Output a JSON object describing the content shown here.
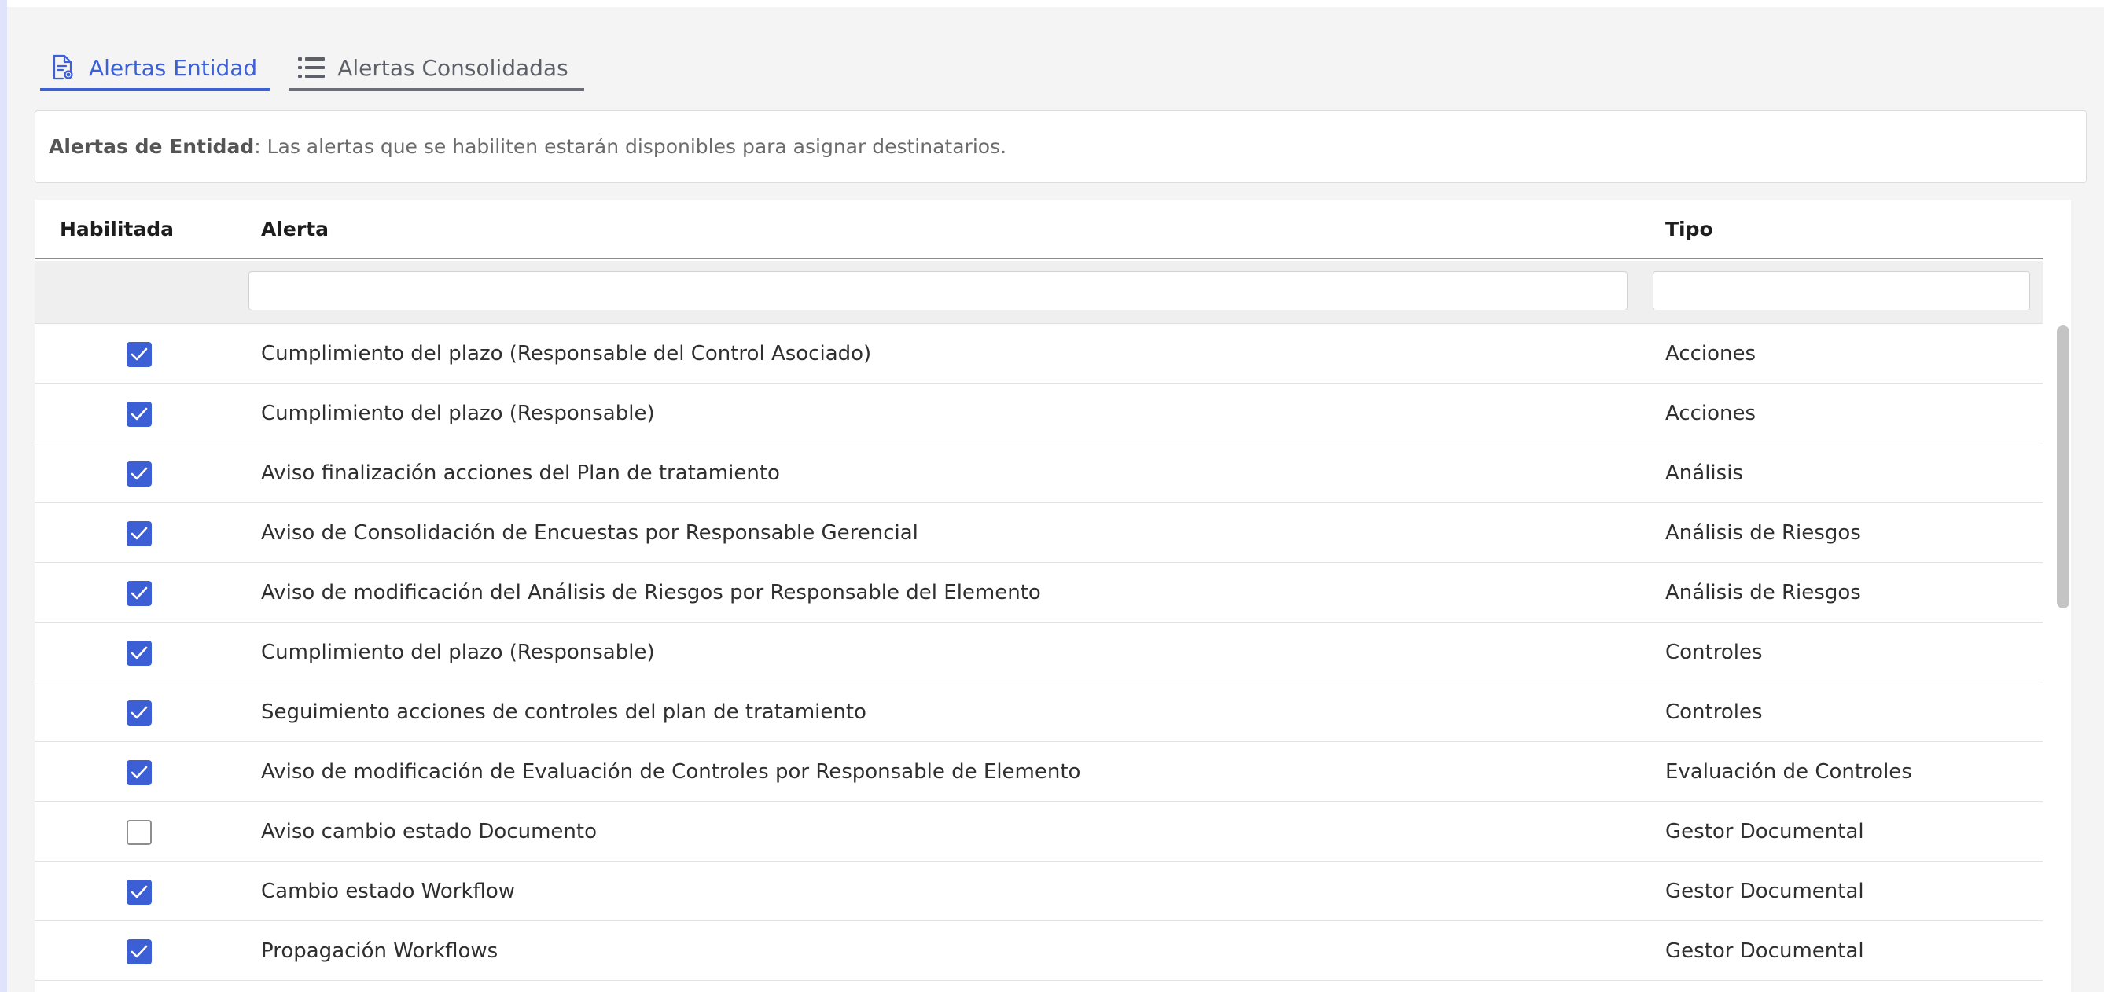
{
  "tabs": [
    {
      "label": "Alertas Entidad",
      "icon": "document-gear-icon",
      "active": true
    },
    {
      "label": "Alertas Consolidadas",
      "icon": "list-icon",
      "active": false
    }
  ],
  "info": {
    "bold": "Alertas de Entidad",
    "text": ": Las alertas que se habiliten estarán disponibles para asignar destinatarios."
  },
  "table": {
    "headers": {
      "habilitada": "Habilitada",
      "alerta": "Alerta",
      "tipo": "Tipo"
    },
    "filters": {
      "alerta": "",
      "tipo": ""
    },
    "rows": [
      {
        "enabled": true,
        "alerta": "Cumplimiento del plazo (Responsable del Control Asociado)",
        "tipo": "Acciones"
      },
      {
        "enabled": true,
        "alerta": "Cumplimiento del plazo (Responsable)",
        "tipo": "Acciones"
      },
      {
        "enabled": true,
        "alerta": "Aviso finalización acciones del Plan de tratamiento",
        "tipo": "Análisis"
      },
      {
        "enabled": true,
        "alerta": "Aviso de Consolidación de Encuestas por Responsable Gerencial",
        "tipo": "Análisis de Riesgos"
      },
      {
        "enabled": true,
        "alerta": "Aviso de modificación del Análisis de Riesgos por Responsable del Elemento",
        "tipo": "Análisis de Riesgos"
      },
      {
        "enabled": true,
        "alerta": "Cumplimiento del plazo (Responsable)",
        "tipo": "Controles"
      },
      {
        "enabled": true,
        "alerta": "Seguimiento acciones de controles del plan de tratamiento",
        "tipo": "Controles"
      },
      {
        "enabled": true,
        "alerta": "Aviso de modificación de Evaluación de Controles por Responsable de Elemento",
        "tipo": "Evaluación de Controles"
      },
      {
        "enabled": false,
        "alerta": "Aviso cambio estado Documento",
        "tipo": "Gestor Documental"
      },
      {
        "enabled": true,
        "alerta": "Cambio estado Workflow",
        "tipo": "Gestor Documental"
      },
      {
        "enabled": true,
        "alerta": "Propagación Workflows",
        "tipo": "Gestor Documental"
      }
    ]
  },
  "colors": {
    "accent": "#3c61d6",
    "checkbox": "#3d5fd6"
  }
}
